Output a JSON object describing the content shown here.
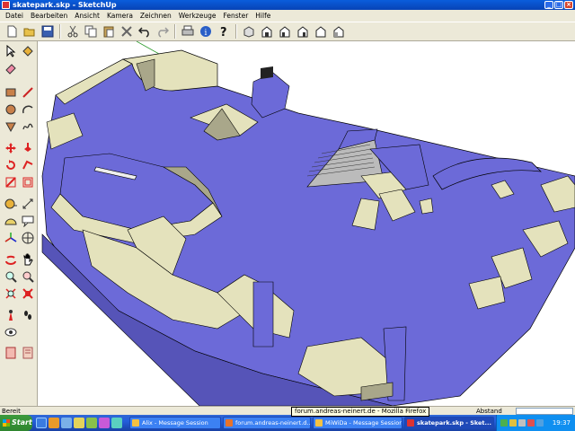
{
  "window": {
    "title": "skatepark.skp - SketchUp",
    "buttons": {
      "minimize": "_",
      "maximize": "□",
      "close": "×"
    }
  },
  "menu": [
    "Datei",
    "Bearbeiten",
    "Ansicht",
    "Kamera",
    "Zeichnen",
    "Werkzeuge",
    "Fenster",
    "Hilfe"
  ],
  "toolbar_icons": [
    "new-icon",
    "open-icon",
    "save-icon",
    "cut-icon",
    "copy-icon",
    "paste-icon",
    "erase-icon",
    "undo-icon",
    "redo-icon",
    "print-icon",
    "model-info-icon",
    "help-icon",
    "iso-view-icon",
    "top-view-icon",
    "front-view-icon",
    "right-view-icon",
    "back-view-icon",
    "left-view-icon"
  ],
  "palette_icons": [
    "select-icon",
    "paint-bucket-icon",
    "eraser-icon",
    "rectangle-icon",
    "line-icon",
    "circle-icon",
    "arc-icon",
    "polygon-icon",
    "freehand-icon",
    "move-icon",
    "push-pull-icon",
    "rotate-icon",
    "follow-me-icon",
    "scale-icon",
    "offset-icon",
    "tape-measure-icon",
    "dimension-icon",
    "protractor-icon",
    "text-icon",
    "axes-icon",
    "3d-text-icon",
    "orbit-icon",
    "pan-icon",
    "zoom-icon",
    "zoom-window-icon",
    "zoom-extents-icon",
    "previous-view-icon",
    "position-camera-icon",
    "walk-icon",
    "look-around-icon",
    "section-plane-icon",
    "component-icon"
  ],
  "colors": {
    "floor": "#6c6ad8",
    "ramp_side": "#e4e2bc",
    "ramp_dark": "#a9a78a",
    "accent": "#0a5ddc"
  },
  "status": {
    "text": "Bereit",
    "measure_label": "Abstand",
    "measure_value": ""
  },
  "tooltip": "forum.andreas-neinert.de - Mozilla Firefox",
  "taskbar": {
    "start": "Start",
    "tasks": [
      {
        "label": "Alix - Message Session",
        "active": false,
        "color": "#f5c142"
      },
      {
        "label": "forum.andreas-neinert.d...",
        "active": false,
        "color": "#e8732a"
      },
      {
        "label": "MiWiDa - Message Session",
        "active": false,
        "color": "#f5c142"
      },
      {
        "label": "skatepark.skp - Sket...",
        "active": true,
        "color": "#d33"
      }
    ],
    "clock": "19:37"
  }
}
